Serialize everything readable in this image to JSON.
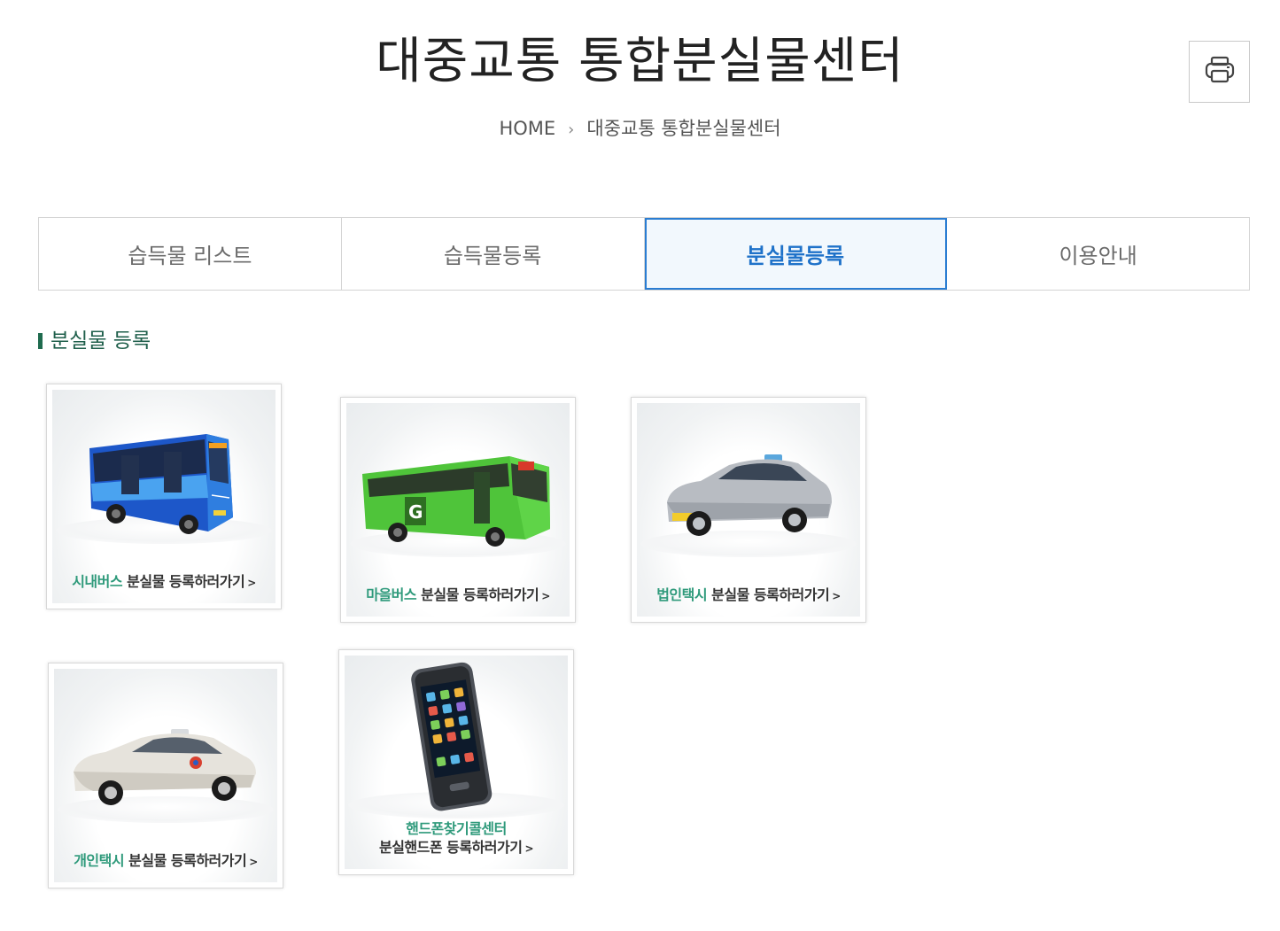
{
  "header": {
    "title": "대중교통 통합분실물센터",
    "print_icon": "printer-icon"
  },
  "breadcrumb": {
    "home": "HOME",
    "separator": "›",
    "current": "대중교통 통합분실물센터"
  },
  "tabs": [
    {
      "label": "습득물 리스트",
      "active": false
    },
    {
      "label": "습득물등록",
      "active": false
    },
    {
      "label": "분실물등록",
      "active": true
    },
    {
      "label": "이용안내",
      "active": false
    }
  ],
  "section": {
    "title": "분실물 등록"
  },
  "cards": [
    {
      "highlight": "시내버스",
      "text": " 분실물 등록하러가기",
      "arrow": ">",
      "icon": "city-bus-image"
    },
    {
      "highlight": "마을버스",
      "text": " 분실물 등록하러가기",
      "arrow": ">",
      "icon": "village-bus-image"
    },
    {
      "highlight": "법인택시",
      "text": " 분실물 등록하러가기",
      "arrow": ">",
      "icon": "corporate-taxi-image"
    },
    {
      "highlight": "개인택시",
      "text": " 분실물 등록하러가기",
      "arrow": ">",
      "icon": "private-taxi-image"
    },
    {
      "highlight": "핸드폰찾기콜센터",
      "text": "분실핸드폰 등록하러가기",
      "arrow": ">",
      "icon": "mobile-phone-image"
    }
  ],
  "colors": {
    "accent_blue": "#1f72c9",
    "accent_green": "#2f9a7b",
    "section_green": "#1f5f4b"
  }
}
